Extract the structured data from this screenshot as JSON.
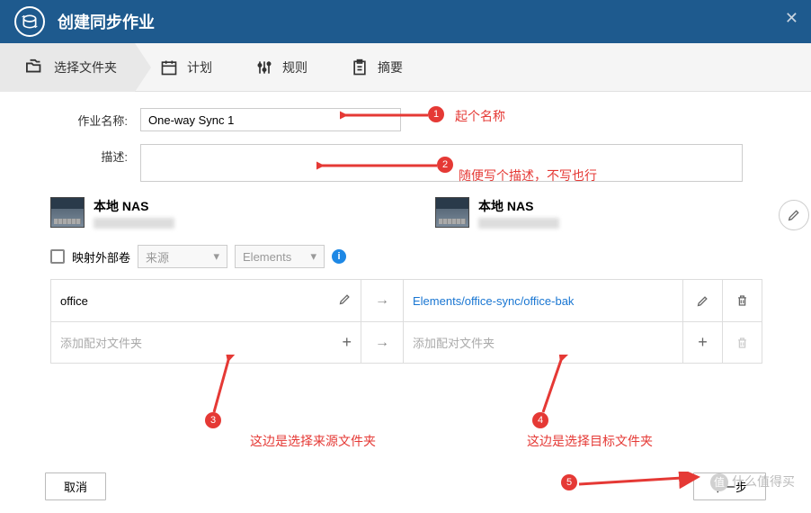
{
  "titlebar": {
    "title": "创建同步作业"
  },
  "steps": {
    "s1": "选择文件夹",
    "s2": "计划",
    "s3": "规则",
    "s4": "摘要"
  },
  "form": {
    "name_label": "作业名称:",
    "name_value": "One-way Sync 1",
    "desc_label": "描述:",
    "desc_value": ""
  },
  "devices": {
    "left_name": "本地 NAS",
    "right_name": "本地 NAS"
  },
  "filter": {
    "map_label": "映射外部卷",
    "select1": "来源",
    "select2": "Elements"
  },
  "pairs": {
    "row1_src": "office",
    "row1_dst": "Elements/office-sync/office-bak",
    "add_placeholder": "添加配对文件夹",
    "arrow": "→"
  },
  "footer": {
    "cancel": "取消",
    "next": "下一步"
  },
  "annotations": {
    "t1": "起个名称",
    "t2": "随便写个描述，不写也行",
    "t3": "这边是选择来源文件夹",
    "t4": "这边是选择目标文件夹"
  },
  "watermark": "什么值得买"
}
